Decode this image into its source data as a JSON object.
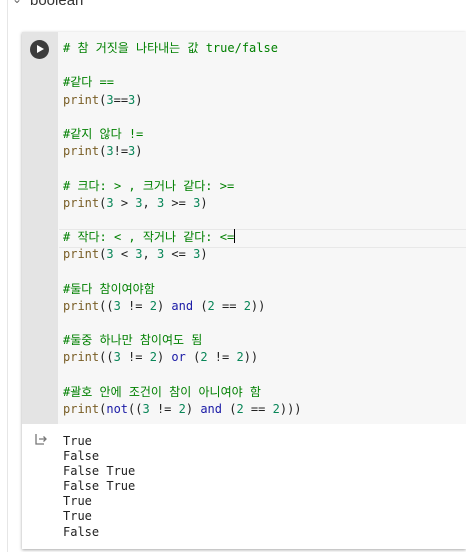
{
  "section": {
    "title": "boolean",
    "caret_icon": "chevron-down-icon"
  },
  "cell": {
    "run_icon": "play-icon",
    "code_lines": [
      {
        "type": "comment",
        "text": "# 참 거짓을 나타내는 값 true/false"
      },
      {
        "type": "blank",
        "text": ""
      },
      {
        "type": "comment",
        "text": "#같다 =="
      },
      {
        "type": "code",
        "tokens": [
          [
            "fn",
            "print"
          ],
          [
            "p",
            "("
          ],
          [
            "num",
            "3"
          ],
          [
            "p",
            "=="
          ],
          [
            "num",
            "3"
          ],
          [
            "p",
            ")"
          ]
        ]
      },
      {
        "type": "blank",
        "text": ""
      },
      {
        "type": "comment",
        "text": "#같지 않다 !="
      },
      {
        "type": "code",
        "tokens": [
          [
            "fn",
            "print"
          ],
          [
            "p",
            "("
          ],
          [
            "num",
            "3"
          ],
          [
            "p",
            "!="
          ],
          [
            "num",
            "3"
          ],
          [
            "p",
            ")"
          ]
        ]
      },
      {
        "type": "blank",
        "text": ""
      },
      {
        "type": "comment",
        "text": "# 크다: > , 크거나 같다: >="
      },
      {
        "type": "code",
        "tokens": [
          [
            "fn",
            "print"
          ],
          [
            "p",
            "("
          ],
          [
            "num",
            "3"
          ],
          [
            "p",
            " > "
          ],
          [
            "num",
            "3"
          ],
          [
            "p",
            ", "
          ],
          [
            "num",
            "3"
          ],
          [
            "p",
            " >= "
          ],
          [
            "num",
            "3"
          ],
          [
            "p",
            ")"
          ]
        ]
      },
      {
        "type": "blank",
        "text": ""
      },
      {
        "type": "comment",
        "text": "# 작다: < , 작거나 같다: <=",
        "cursor": true
      },
      {
        "type": "code",
        "tokens": [
          [
            "fn",
            "print"
          ],
          [
            "p",
            "("
          ],
          [
            "num",
            "3"
          ],
          [
            "p",
            " < "
          ],
          [
            "num",
            "3"
          ],
          [
            "p",
            ", "
          ],
          [
            "num",
            "3"
          ],
          [
            "p",
            " <= "
          ],
          [
            "num",
            "3"
          ],
          [
            "p",
            ")"
          ]
        ]
      },
      {
        "type": "blank",
        "text": ""
      },
      {
        "type": "comment",
        "text": "#둘다 참이여야함"
      },
      {
        "type": "code",
        "tokens": [
          [
            "fn",
            "print"
          ],
          [
            "p",
            "(("
          ],
          [
            "num",
            "3"
          ],
          [
            "p",
            " != "
          ],
          [
            "num",
            "2"
          ],
          [
            "p",
            ") "
          ],
          [
            "kw",
            "and"
          ],
          [
            "p",
            " ("
          ],
          [
            "num",
            "2"
          ],
          [
            "p",
            " == "
          ],
          [
            "num",
            "2"
          ],
          [
            "p",
            "))"
          ]
        ]
      },
      {
        "type": "blank",
        "text": ""
      },
      {
        "type": "comment",
        "text": "#둘중 하나만 참이여도 됨"
      },
      {
        "type": "code",
        "tokens": [
          [
            "fn",
            "print"
          ],
          [
            "p",
            "(("
          ],
          [
            "num",
            "3"
          ],
          [
            "p",
            " != "
          ],
          [
            "num",
            "2"
          ],
          [
            "p",
            ") "
          ],
          [
            "kw",
            "or"
          ],
          [
            "p",
            " ("
          ],
          [
            "num",
            "2"
          ],
          [
            "p",
            " != "
          ],
          [
            "num",
            "2"
          ],
          [
            "p",
            "))"
          ]
        ]
      },
      {
        "type": "blank",
        "text": ""
      },
      {
        "type": "comment",
        "text": "#괄호 안에 조건이 참이 아니여야 함"
      },
      {
        "type": "code",
        "tokens": [
          [
            "fn",
            "print"
          ],
          [
            "p",
            "("
          ],
          [
            "kw",
            "not"
          ],
          [
            "p",
            "(("
          ],
          [
            "num",
            "3"
          ],
          [
            "p",
            " != "
          ],
          [
            "num",
            "2"
          ],
          [
            "p",
            ") "
          ],
          [
            "kw",
            "and"
          ],
          [
            "p",
            " ("
          ],
          [
            "num",
            "2"
          ],
          [
            "p",
            " == "
          ],
          [
            "num",
            "2"
          ],
          [
            "p",
            ")))"
          ]
        ]
      }
    ],
    "output_icon": "output-redirect-icon",
    "output_lines": [
      "True",
      "False",
      "False True",
      "False True",
      "True",
      "True",
      "False"
    ]
  },
  "colors": {
    "comment": "#008000",
    "number": "#098658",
    "keyword": "#1a1aa6",
    "function": "#795e26",
    "code_bg": "#f7f7f7",
    "gutter_bg": "#e4e4e4"
  }
}
